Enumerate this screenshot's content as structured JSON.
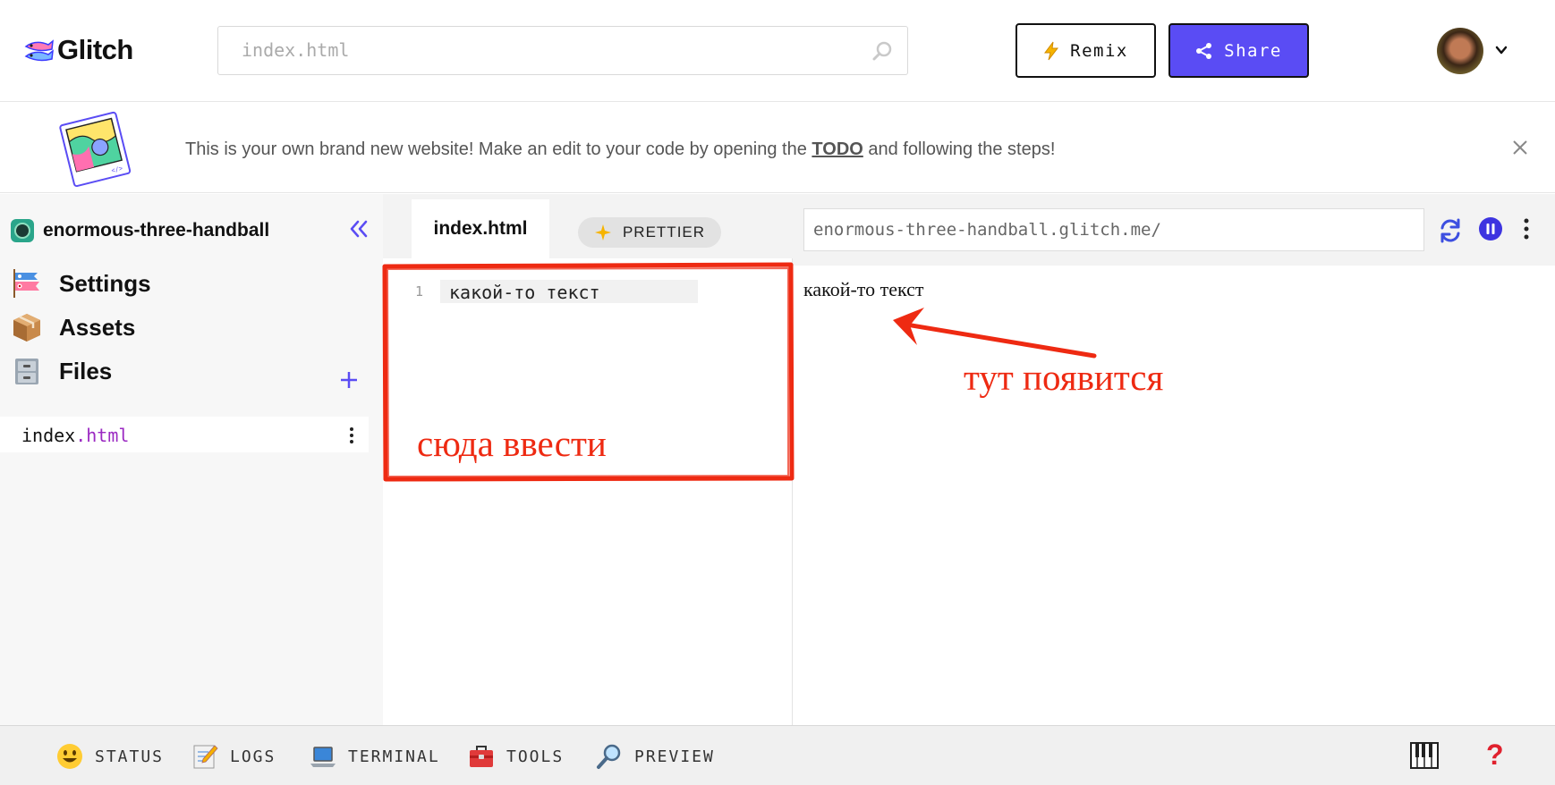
{
  "header": {
    "app_name": "Glitch",
    "search": {
      "placeholder": "index.html"
    },
    "remix_label": "Remix",
    "share_label": "Share",
    "brand_color": "#5a4cf4"
  },
  "banner": {
    "text_before": "This is your own brand new website! Make an edit to your code by opening the ",
    "todo_link": "TODO",
    "text_after": " and following the steps!"
  },
  "sidebar": {
    "project_name": "enormous-three-handball",
    "nav": [
      {
        "label": "Settings",
        "icon": "koinobori-icon"
      },
      {
        "label": "Assets",
        "icon": "package-icon"
      },
      {
        "label": "Files",
        "icon": "file-cabinet-icon"
      }
    ],
    "files": [
      {
        "basename": "index",
        "extension": ".html"
      }
    ]
  },
  "editor": {
    "active_tab": "index.html",
    "prettier_label": "PRETTIER",
    "lines": [
      {
        "number": "1",
        "text": "какой-то текст"
      }
    ]
  },
  "preview": {
    "url": "enormous-three-handball.glitch.me/",
    "body_text": "какой-то текст"
  },
  "bottombar": {
    "items": [
      {
        "label": "STATUS",
        "icon": "smiley-icon"
      },
      {
        "label": "LOGS",
        "icon": "memo-icon"
      },
      {
        "label": "TERMINAL",
        "icon": "laptop-icon"
      },
      {
        "label": "TOOLS",
        "icon": "toolbox-icon"
      },
      {
        "label": "PREVIEW",
        "icon": "magnifier-icon"
      }
    ],
    "help_label": "?"
  },
  "annotations": {
    "input_hint": "сюда ввести",
    "output_hint": "тут появится",
    "color": "#ee2a12"
  }
}
